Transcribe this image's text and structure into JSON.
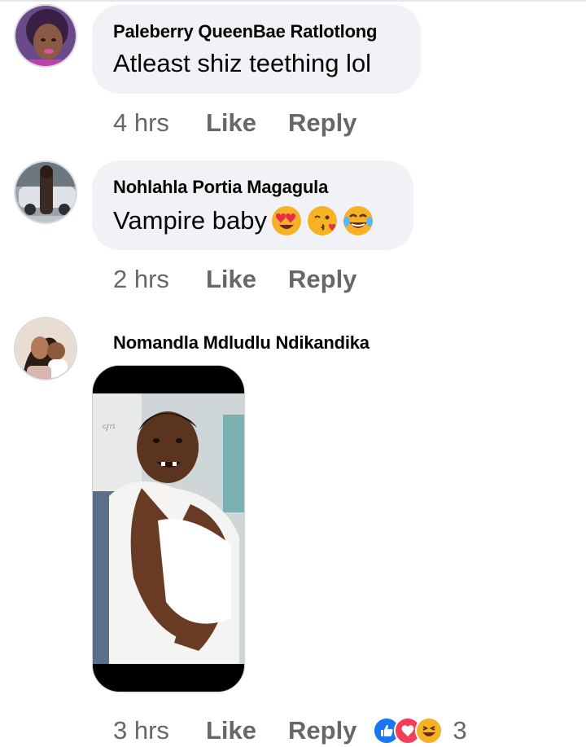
{
  "comments": [
    {
      "author": "Paleberry QueenBae Ratlotlong",
      "text": "Atleast shiz teething lol",
      "time": "4 hrs",
      "like_label": "Like",
      "reply_label": "Reply"
    },
    {
      "author": "Nohlahla Portia Magagula",
      "text": "Vampire baby",
      "emojis": [
        "heart-eyes-emoji",
        "kissing-face-emoji",
        "tears-of-joy-emoji"
      ],
      "time": "2 hrs",
      "like_label": "Like",
      "reply_label": "Reply"
    },
    {
      "author": "Nomandla Mdludlu Ndikandika",
      "attachment": "photo of smiling baby wrapped in white towel",
      "time": "3 hrs",
      "like_label": "Like",
      "reply_label": "Reply",
      "reactions": [
        "like-reaction-icon",
        "love-reaction-icon",
        "haha-reaction-icon"
      ],
      "reaction_count": "3"
    }
  ],
  "colors": {
    "bubble": "#f0f2f5",
    "meta_text": "#65676b",
    "like_blue": "#1877f2",
    "love_red": "#f33e58",
    "haha_yellow": "#f7b125"
  }
}
